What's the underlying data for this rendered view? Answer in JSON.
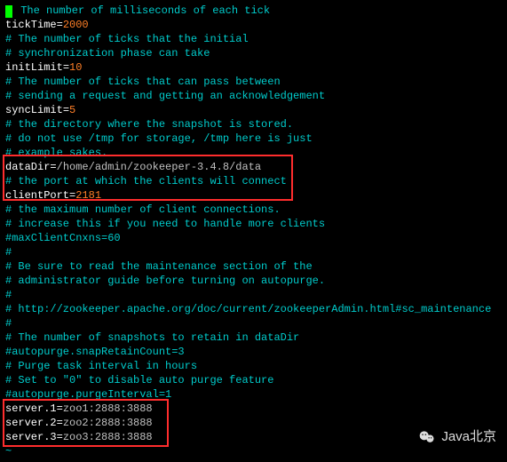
{
  "config": {
    "tickTime_comment": " The number of milliseconds of each tick",
    "tickTime_key": "tickTime",
    "tickTime_val": "2000",
    "initLimit_c1": "# The number of ticks that the initial",
    "initLimit_c2": "# synchronization phase can take",
    "initLimit_key": "initLimit",
    "initLimit_val": "10",
    "syncLimit_c1": "# The number of ticks that can pass between",
    "syncLimit_c2": "# sending a request and getting an acknowledgement",
    "syncLimit_key": "syncLimit",
    "syncLimit_val": "5",
    "dataDir_c1": "# the directory where the snapshot is stored.",
    "dataDir_c2": "# do not use /tmp for storage, /tmp here is just",
    "dataDir_c3": "# example sakes.",
    "dataDir_key": "dataDir",
    "dataDir_val": "/home/admin/zookeeper-3.4.8/data",
    "clientPort_c1": "# the port at which the clients will connect",
    "clientPort_key": "clientPort",
    "clientPort_val": "2181",
    "maxcnx_c1": "# the maximum number of client connections.",
    "maxcnx_c2": "# increase this if you need to handle more clients",
    "maxcnx_line": "#maxClientCnxns=60",
    "hash1": "#",
    "maint_c1": "# Be sure to read the maintenance section of the",
    "maint_c2": "# administrator guide before turning on autopurge.",
    "hash2": "#",
    "maint_url": "# http://zookeeper.apache.org/doc/current/zookeeperAdmin.html#sc_maintenance",
    "hash3": "#",
    "snap_c1": "# The number of snapshots to retain in dataDir",
    "snap_line": "#autopurge.snapRetainCount=3",
    "purge_c1": "# Purge task interval in hours",
    "purge_c2": "# Set to \"0\" to disable auto purge feature",
    "purge_line": "#autopurge.purgeInterval=1",
    "s1_key": "server.1",
    "s1_val": "zoo1:2888:3888",
    "s2_key": "server.2",
    "s2_val": "zoo2:2888:3888",
    "s3_key": "server.3",
    "s3_val": "zoo3:2888:3888"
  },
  "watermark": "Java北京"
}
